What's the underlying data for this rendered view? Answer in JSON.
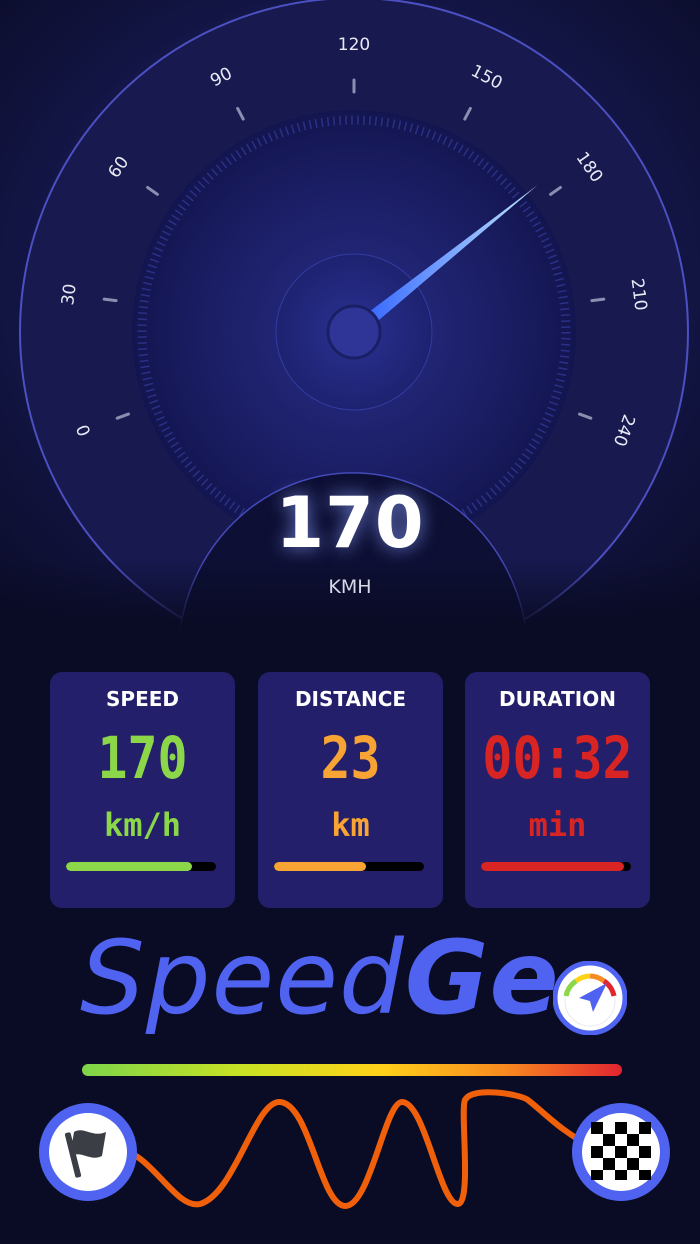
{
  "gauge": {
    "scale_labels": [
      "0",
      "30",
      "60",
      "90",
      "120",
      "150",
      "180",
      "210",
      "240"
    ],
    "needle_value": 176,
    "max_value": 240,
    "speed_value": "170",
    "unit": "KMH"
  },
  "cards": [
    {
      "title": "SPEED",
      "value": "170",
      "unit": "km/h",
      "progress": 0.84,
      "color": "#8bd649"
    },
    {
      "title": "DISTANCE",
      "value": "23",
      "unit": "km",
      "progress": 0.61,
      "color": "#f8a434"
    },
    {
      "title": "DURATION",
      "value": "00:32",
      "unit": "min",
      "progress": 0.95,
      "color": "#d92424"
    }
  ],
  "brand": {
    "name_part1": "Speed",
    "name_part2": "Ge",
    "accent_color": "#4f63f0"
  },
  "route": {
    "start_icon": "flag-icon",
    "end_icon": "checkered-flag-icon",
    "path_color": "#f0600a"
  }
}
